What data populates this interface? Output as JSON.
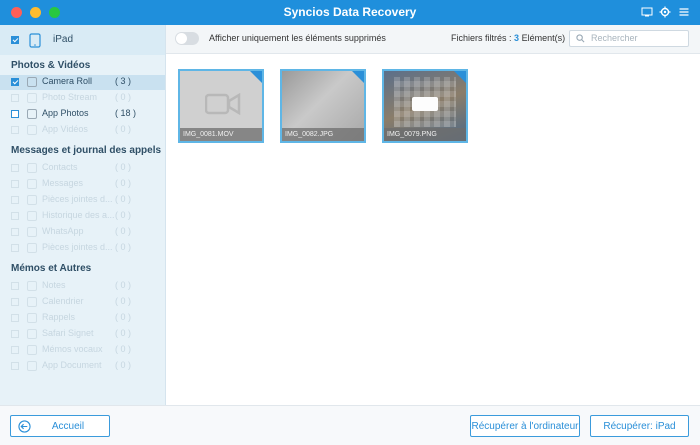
{
  "window": {
    "title": "Syncios Data Recovery"
  },
  "device": {
    "name": "iPad"
  },
  "sections": [
    {
      "title": "Photos & Vidéos",
      "items": [
        {
          "label": "Camera Roll",
          "count": "( 3 )",
          "state": "selected"
        },
        {
          "label": "Photo Stream",
          "count": "( 0 )",
          "state": "dim"
        },
        {
          "label": "App Photos",
          "count": "( 18 )",
          "state": "normal"
        },
        {
          "label": "App Vidéos",
          "count": "( 0 )",
          "state": "dim"
        }
      ]
    },
    {
      "title": "Messages et journal des appels",
      "items": [
        {
          "label": "Contacts",
          "count": "( 0 )",
          "state": "dim"
        },
        {
          "label": "Messages",
          "count": "( 0 )",
          "state": "dim"
        },
        {
          "label": "Pièces jointes d...",
          "count": "( 0 )",
          "state": "dim"
        },
        {
          "label": "Historique des a...",
          "count": "( 0 )",
          "state": "dim"
        },
        {
          "label": "WhatsApp",
          "count": "( 0 )",
          "state": "dim"
        },
        {
          "label": "Pièces jointes d...",
          "count": "( 0 )",
          "state": "dim"
        }
      ]
    },
    {
      "title": "Mémos et Autres",
      "items": [
        {
          "label": "Notes",
          "count": "( 0 )",
          "state": "dim"
        },
        {
          "label": "Calendrier",
          "count": "( 0 )",
          "state": "dim"
        },
        {
          "label": "Rappels",
          "count": "( 0 )",
          "state": "dim"
        },
        {
          "label": "Safari Signet",
          "count": "( 0 )",
          "state": "dim"
        },
        {
          "label": "Mémos vocaux",
          "count": "( 0 )",
          "state": "dim"
        },
        {
          "label": "App Document",
          "count": "( 0 )",
          "state": "dim"
        }
      ]
    }
  ],
  "toolbar": {
    "toggle_label": "Afficher uniquement les éléments supprimés",
    "filter_label": "Fichiers filtrés :",
    "filter_count": "3",
    "filter_suffix": "Elément(s)",
    "search_placeholder": "Rechercher"
  },
  "thumbnails": [
    {
      "name": "IMG_0081.MOV",
      "kind": "video"
    },
    {
      "name": "IMG_0082.JPG",
      "kind": "photo"
    },
    {
      "name": "IMG_0079.PNG",
      "kind": "screenshot"
    }
  ],
  "footer": {
    "home_label": "Accueil",
    "recover_computer_label": "Récupérer à l'ordinateur",
    "recover_device_label": "Récupérer: iPad"
  },
  "colors": {
    "accent": "#2a8fd8",
    "titlebar": "#1f8fdc"
  }
}
